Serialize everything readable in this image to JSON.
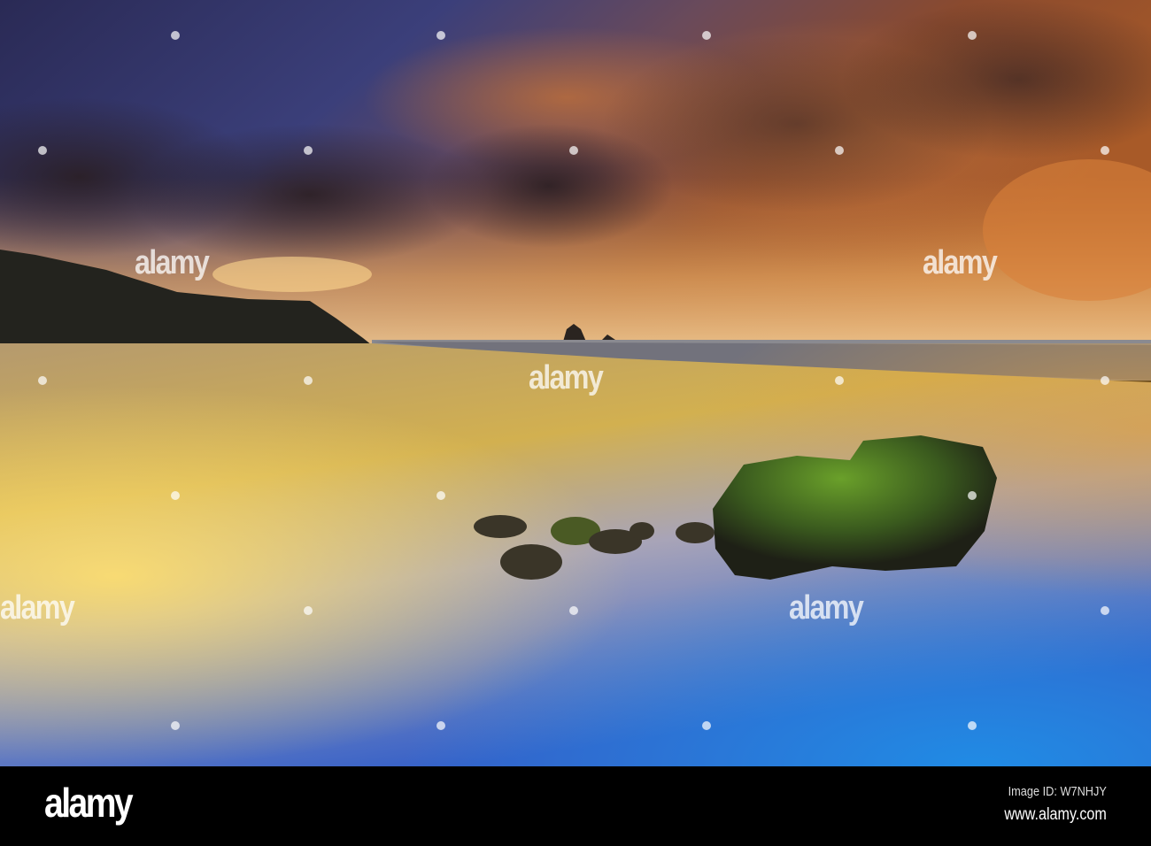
{
  "watermark": {
    "text": "alamy"
  },
  "footer": {
    "logo": "alamy",
    "image_id": "Image ID: W7NHJY",
    "website": "www.alamy.com"
  }
}
